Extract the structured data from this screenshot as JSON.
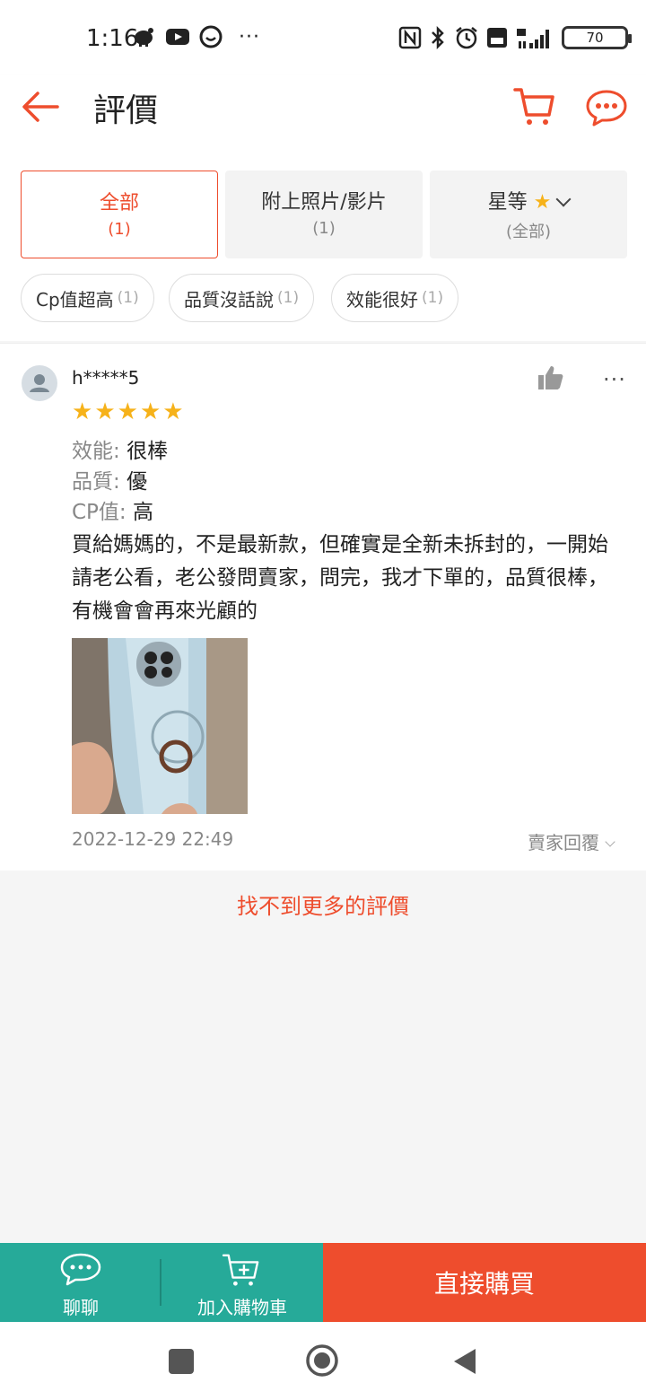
{
  "status_bar": {
    "time": "1:16",
    "battery": "70",
    "left_icons": [
      "piggy-bank-icon",
      "youtube-icon",
      "chat-bubble-icon",
      "more-dots-icon"
    ],
    "right_icons": [
      "nfc-icon",
      "bluetooth-icon",
      "alarm-icon",
      "volte-icon",
      "signal-4g-icon",
      "battery-icon"
    ]
  },
  "header": {
    "title": "評價",
    "back_icon": "arrow-left-icon",
    "cart_icon": "cart-icon",
    "chat_icon": "chat-icon"
  },
  "filters": {
    "tabs": [
      {
        "label": "全部",
        "count": "(1)",
        "active": true
      },
      {
        "label": "附上照片/影片",
        "count": "(1)",
        "active": false
      },
      {
        "label": "星等",
        "count": "(全部)",
        "active": false
      }
    ],
    "chips": [
      {
        "label": "Cp值超高",
        "count": "(1)"
      },
      {
        "label": "品質沒話說",
        "count": "(1)"
      },
      {
        "label": "效能很好",
        "count": "(1)"
      }
    ]
  },
  "review": {
    "username": "h*****5",
    "rating": 5,
    "attributes": [
      {
        "key": "效能:",
        "value": "很棒"
      },
      {
        "key": "品質:",
        "value": "優"
      },
      {
        "key": "CP值:",
        "value": "高"
      }
    ],
    "comment": "買給媽媽的，不是最新款，但確實是全新未拆封的，一開始請老公看，老公發問賣家，問完，我才下單的，品質很棒，有機會會再來光顧的",
    "date": "2022-12-29 22:49",
    "seller_reply": "賣家回覆"
  },
  "footer_text": "找不到更多的評價",
  "bottom_bar": {
    "chat_label": "聊聊",
    "cart_label": "加入購物車",
    "buy_label": "直接購買"
  },
  "colors": {
    "brand_orange": "#ee4d2d",
    "teal": "#26aa99",
    "star": "#f6b21a"
  }
}
